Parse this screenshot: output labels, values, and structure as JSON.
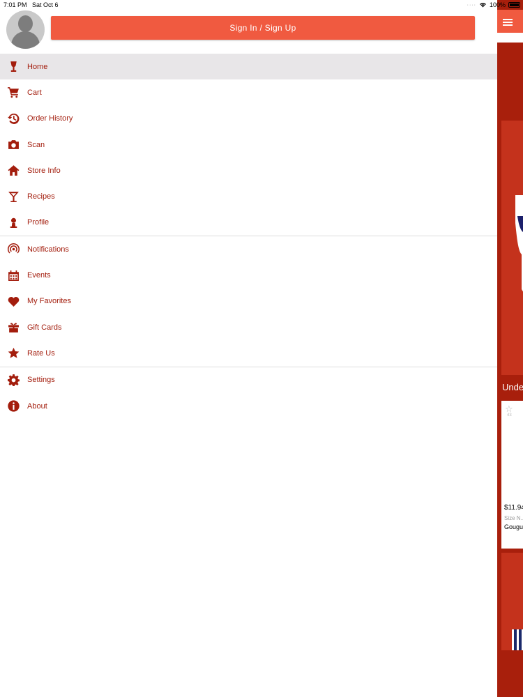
{
  "status_bar": {
    "time": "7:01 PM",
    "date": "Sat Oct 6",
    "battery": "100%"
  },
  "drawer": {
    "signin_label": "Sign In / Sign Up",
    "menu": [
      {
        "label": "Home",
        "icon": "wine-glass-icon",
        "active": true
      },
      {
        "label": "Cart",
        "icon": "cart-icon"
      },
      {
        "label": "Order History",
        "icon": "history-icon"
      },
      {
        "label": "Scan",
        "icon": "camera-icon"
      },
      {
        "label": "Store Info",
        "icon": "store-icon"
      },
      {
        "label": "Recipes",
        "icon": "cocktail-icon"
      },
      {
        "label": "Profile",
        "icon": "person-icon"
      },
      {
        "label": "Notifications",
        "icon": "broadcast-icon"
      },
      {
        "label": "Events",
        "icon": "calendar-icon"
      },
      {
        "label": "My Favorites",
        "icon": "heart-icon"
      },
      {
        "label": "Gift Cards",
        "icon": "gift-icon"
      },
      {
        "label": "Rate Us",
        "icon": "star-icon"
      },
      {
        "label": "Settings",
        "icon": "gear-icon"
      },
      {
        "label": "About",
        "icon": "info-icon"
      }
    ]
  },
  "background": {
    "section_title_partial": "Unde",
    "card": {
      "rating_count": "43",
      "price": "$11.94",
      "size": "Size N...",
      "name": "Gougu..."
    }
  },
  "colors": {
    "accent": "#f05a40",
    "brand_dark": "#a31d0d",
    "active_row": "#e8e6e8"
  }
}
